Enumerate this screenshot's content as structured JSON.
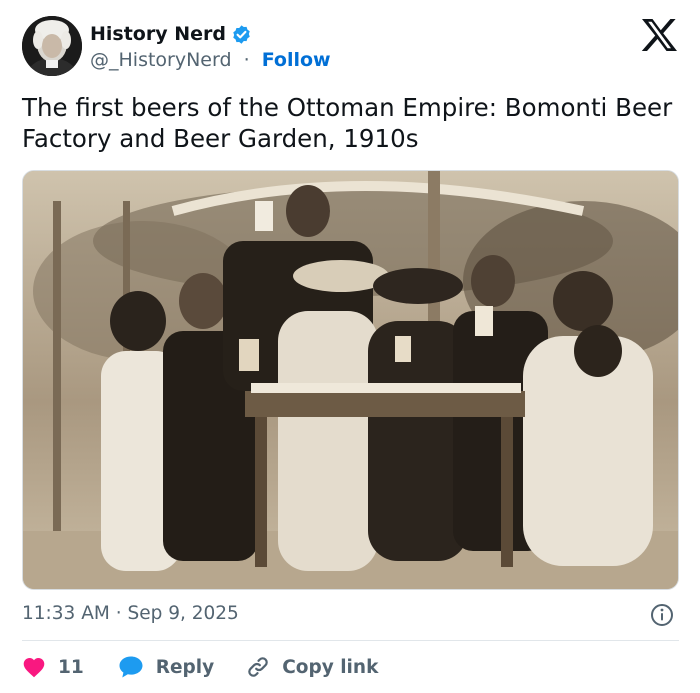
{
  "author": {
    "name": "History Nerd",
    "handle": "@_HistoryNerd",
    "separator": "·",
    "follow_label": "Follow"
  },
  "tweet": {
    "text": "The first beers of the Ottoman Empire: Bomonti Beer Factory and Beer Garden, 1910s",
    "timestamp": "11:33 AM · Sep 9, 2025"
  },
  "actions": {
    "like_count": "11",
    "reply_label": "Reply",
    "copy_link_label": "Copy link"
  },
  "icons": {
    "verified": "verified-badge-icon",
    "brand": "x-logo-icon",
    "info": "info-icon",
    "like": "heart-icon",
    "reply": "speech-bubble-icon",
    "copy": "link-icon"
  },
  "colors": {
    "text": "#0f1419",
    "secondary": "#536471",
    "accent": "#006fd6",
    "verified": "#1d9bf0",
    "like": "#f91880"
  }
}
